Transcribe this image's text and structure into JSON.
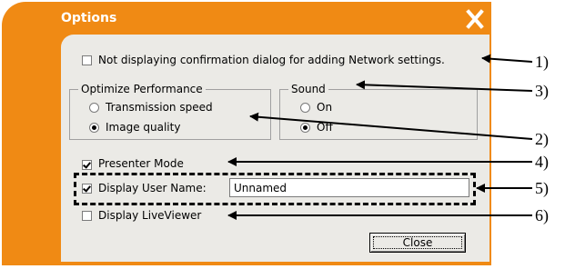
{
  "window": {
    "title": "Options",
    "close_icon": "close-x-icon"
  },
  "options": {
    "no_confirm_network": {
      "label": "Not displaying confirmation dialog for adding Network settings.",
      "checked": false
    },
    "optimize_performance": {
      "title": "Optimize Performance",
      "options": [
        {
          "label": "Transmission speed",
          "selected": false
        },
        {
          "label": "Image quality",
          "selected": true
        }
      ]
    },
    "sound": {
      "title": "Sound",
      "options": [
        {
          "label": "On",
          "selected": false
        },
        {
          "label": "Off",
          "selected": true
        }
      ]
    },
    "presenter_mode": {
      "label": "Presenter Mode",
      "checked": true
    },
    "display_user_name": {
      "label": "Display User Name:",
      "checked": true,
      "value": "Unnamed"
    },
    "display_liveviewer": {
      "label": "Display LiveViewer",
      "checked": false
    },
    "close_button": "Close"
  },
  "callouts": [
    "1)",
    "3)",
    "2)",
    "4)",
    "5)",
    "6)"
  ],
  "colors": {
    "frame": "#f08a14",
    "client": "#ebeae6",
    "title_text": "#ffffff"
  }
}
